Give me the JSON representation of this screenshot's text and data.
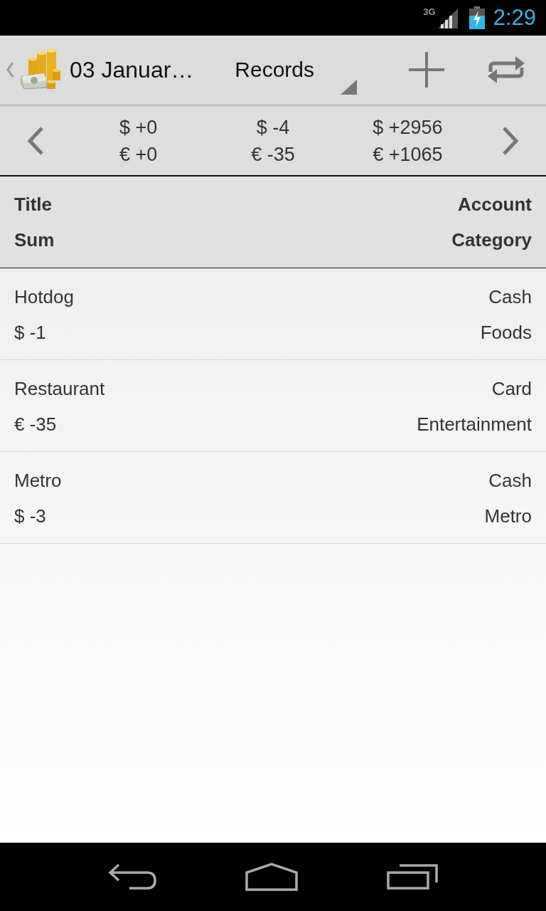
{
  "status_bar": {
    "network": "3G",
    "time": "2:29"
  },
  "action_bar": {
    "title": "03 Januar…",
    "spinner": "Records"
  },
  "summary": {
    "columns": [
      {
        "dollar": "$ +0",
        "euro": "€ +0"
      },
      {
        "dollar": "$ -4",
        "euro": "€ -35"
      },
      {
        "dollar": "$ +2956",
        "euro": "€ +1065"
      }
    ]
  },
  "table": {
    "header": {
      "title": "Title",
      "account": "Account",
      "sum": "Sum",
      "category": "Category"
    },
    "rows": [
      {
        "title": "Hotdog",
        "account": "Cash",
        "sum": "$ -1",
        "category": "Foods"
      },
      {
        "title": "Restaurant",
        "account": "Card",
        "sum": "€ -35",
        "category": "Entertainment"
      },
      {
        "title": "Metro",
        "account": "Cash",
        "sum": "$ -3",
        "category": "Metro"
      }
    ]
  }
}
